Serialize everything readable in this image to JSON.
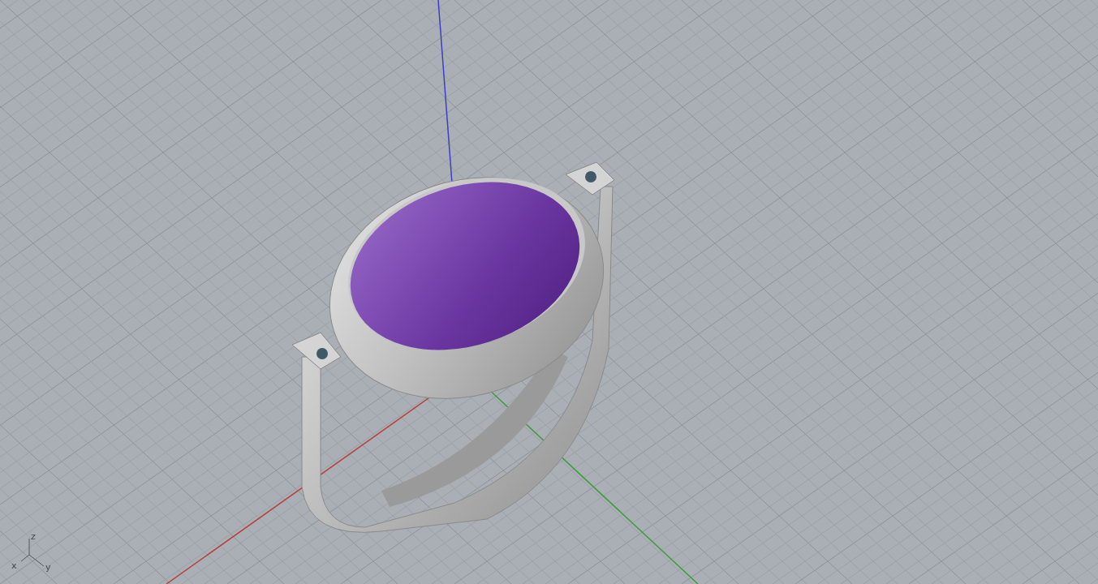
{
  "viewport": {
    "gizmo_labels": [
      "z",
      "x",
      "y"
    ]
  }
}
